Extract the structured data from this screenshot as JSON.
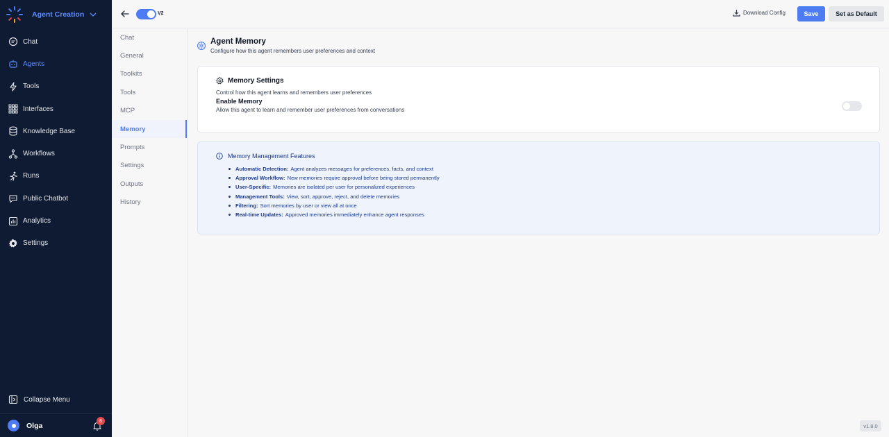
{
  "brand": {
    "title": "Agent Creation"
  },
  "nav": {
    "items": [
      {
        "label": "Chat",
        "icon": "chat-icon"
      },
      {
        "label": "Agents",
        "icon": "robot-icon",
        "active": true
      },
      {
        "label": "Tools",
        "icon": "bolt-icon"
      },
      {
        "label": "Interfaces",
        "icon": "grid-icon"
      },
      {
        "label": "Knowledge Base",
        "icon": "database-icon"
      },
      {
        "label": "Workflows",
        "icon": "workflow-icon"
      },
      {
        "label": "Runs",
        "icon": "runner-icon"
      },
      {
        "label": "Public Chatbot",
        "icon": "chatbot-icon"
      },
      {
        "label": "Analytics",
        "icon": "analytics-icon"
      },
      {
        "label": "Settings",
        "icon": "gear-icon"
      }
    ],
    "collapse_label": "Collapse Menu"
  },
  "user": {
    "name": "Olga",
    "notifications": "8"
  },
  "topbar": {
    "version_label": "V2",
    "download_label": "Download Config",
    "save_label": "Save",
    "default_label": "Set as Default"
  },
  "subnav": {
    "items": [
      "Chat",
      "General",
      "Toolkits",
      "Tools",
      "MCP",
      "Memory",
      "Prompts",
      "Settings",
      "Outputs",
      "History"
    ],
    "active": "Memory"
  },
  "main": {
    "title": "Agent Memory",
    "description": "Configure how this agent remembers user preferences and context",
    "settings_card": {
      "title": "Memory Settings",
      "description": "Control how this agent learns and remembers user preferences",
      "field_label": "Enable Memory",
      "field_description": "Allow this agent to learn and remember user preferences from conversations",
      "enabled": false
    },
    "info_card": {
      "title": "Memory Management Features",
      "features": [
        {
          "name": "Automatic Detection:",
          "text": "Agent analyzes messages for preferences, facts, and context"
        },
        {
          "name": "Approval Workflow:",
          "text": "New memories require approval before being stored permanently"
        },
        {
          "name": "User-Specific:",
          "text": "Memories are isolated per user for personalized experiences"
        },
        {
          "name": "Management Tools:",
          "text": "View, sort, approve, reject, and delete memories"
        },
        {
          "name": "Filtering:",
          "text": "Sort memories by user or view all at once"
        },
        {
          "name": "Real-time Updates:",
          "text": "Approved memories immediately enhance agent responses"
        }
      ]
    }
  },
  "app_version": "v1.8.0",
  "colors": {
    "accent": "#4d7cf5",
    "nav_bg": "#0f1b33",
    "info_bg": "#eef3fc",
    "info_text": "#1e3a8a"
  }
}
